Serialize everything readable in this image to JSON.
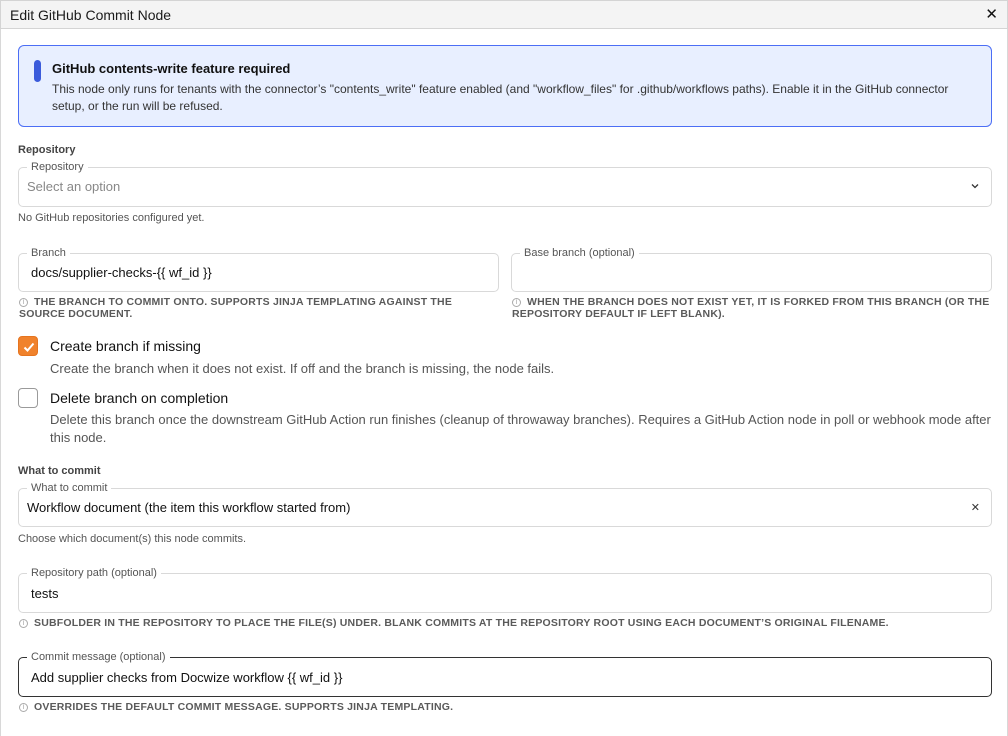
{
  "window": {
    "title": "Edit GitHub Commit Node",
    "close_glyph": "✕"
  },
  "alert": {
    "title": "GitHub contents-write feature required",
    "body": "This node only runs for tenants with the connector’s \"contents_write\" feature enabled (and \"workflow_files\" for .github/workflows paths). Enable it in the GitHub connector setup, or the run will be refused.",
    "color": "#4c6ef5"
  },
  "repository": {
    "section_label": "Repository",
    "legend": "Repository",
    "placeholder": "Select an option",
    "helper": "No GitHub repositories configured yet.",
    "icon": "chevron-down-icon"
  },
  "branch": {
    "legend": "Branch",
    "value": "docs/supplier-checks-{{ wf_id }}",
    "helper": "The branch to commit onto. Supports Jinja templating against the source document."
  },
  "base_branch": {
    "legend": "Base branch (optional)",
    "value": "",
    "helper": "When the branch does not exist yet, it is forked from this branch (or the repository default if left blank)."
  },
  "create_branch": {
    "label": "Create branch if missing",
    "checked": true,
    "description": "Create the branch when it does not exist. If off and the branch is missing, the node fails.",
    "accent": "#f0822c"
  },
  "delete_branch": {
    "label": "Delete branch on completion",
    "checked": false,
    "description": "Delete this branch once the downstream GitHub Action run finishes (cleanup of throwaway branches). Requires a GitHub Action node in poll or webhook mode after this node."
  },
  "what_to_commit": {
    "section_label": "What to commit",
    "legend": "What to commit",
    "value": "Workflow document (the item this workflow started from)",
    "helper": "Choose which document(s) this node commits.",
    "clear_glyph": "✕"
  },
  "repo_path": {
    "legend": "Repository path (optional)",
    "value": "tests",
    "helper": "Subfolder in the repository to place the file(s) under. Blank commits at the repository root using each document’s original filename."
  },
  "commit_message": {
    "legend": "Commit message (optional)",
    "value": "Add supplier checks from Docwize workflow {{ wf_id }}",
    "helper": "Overrides the default commit message. Supports Jinja templating."
  },
  "info_glyph": "i"
}
